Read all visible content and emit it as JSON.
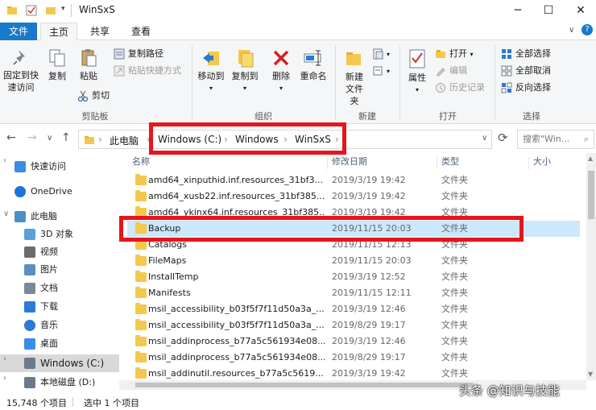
{
  "window": {
    "title": "WinSxS",
    "minimize": "─",
    "maximize": "☐",
    "close": "✕"
  },
  "tabs": {
    "file": "文件",
    "home": "主页",
    "share": "共享",
    "view": "查看"
  },
  "ribbon": {
    "clipboard": {
      "pin": "固定到快速访问",
      "copy": "复制",
      "paste": "粘贴",
      "copy_path": "复制路径",
      "paste_shortcut": "粘贴快捷方式",
      "cut": "剪切",
      "group": "剪贴板"
    },
    "organize": {
      "move_to": "移动到",
      "copy_to": "复制到",
      "delete": "删除",
      "rename": "重命名",
      "group": "组织"
    },
    "new": {
      "new_folder": "新建文件夹",
      "group": "新建"
    },
    "open": {
      "properties": "属性",
      "open": "打开",
      "edit": "编辑",
      "history": "历史记录",
      "group": "打开"
    },
    "select": {
      "select_all": "全部选择",
      "select_none": "全部取消",
      "invert": "反向选择",
      "group": "选择"
    }
  },
  "address": {
    "c1": "此电脑",
    "c2": "Windows (C:)",
    "c3": "Windows",
    "c4": "WinSxS",
    "search_placeholder": "搜索\"Win..."
  },
  "nav": [
    {
      "label": "快速访问",
      "icon": "star-icon",
      "color": "#3a8ee6"
    },
    {
      "label": "OneDrive",
      "icon": "cloud-icon",
      "color": "#1a73d9"
    },
    {
      "label": "此电脑",
      "icon": "computer-icon",
      "color": "#4a90c8"
    },
    {
      "label": "3D 对象",
      "icon": "cube-icon",
      "color": "#5aa0d8"
    },
    {
      "label": "视频",
      "icon": "video-icon",
      "color": "#6c6c6c"
    },
    {
      "label": "图片",
      "icon": "picture-icon",
      "color": "#5a8fbf"
    },
    {
      "label": "文档",
      "icon": "document-icon",
      "color": "#7a8a9a"
    },
    {
      "label": "下载",
      "icon": "download-icon",
      "color": "#2a7ad6"
    },
    {
      "label": "音乐",
      "icon": "music-icon",
      "color": "#2a7ad6"
    },
    {
      "label": "桌面",
      "icon": "desktop-icon",
      "color": "#3a8ee6"
    },
    {
      "label": "Windows (C:)",
      "icon": "drive-icon",
      "color": "#6a7a8a"
    },
    {
      "label": "本地磁盘 (D:)",
      "icon": "drive-icon",
      "color": "#6a7a8a"
    }
  ],
  "columns": {
    "name": "名称",
    "date": "修改日期",
    "type": "类型",
    "size": "大小"
  },
  "files": [
    {
      "name": "amd64_xinputhid.inf.resources_31bf3...",
      "date": "2019/3/19 19:42",
      "type": "文件夹"
    },
    {
      "name": "amd64_xusb22.inf.resources_31bf385...",
      "date": "2019/3/19 19:42",
      "type": "文件夹"
    },
    {
      "name": "amd64_ykinx64.inf.resources_31bf385...",
      "date": "2019/3/19 19:42",
      "type": "文件夹"
    },
    {
      "name": "Backup",
      "date": "2019/11/15 20:03",
      "type": "文件夹"
    },
    {
      "name": "Catalogs",
      "date": "2019/11/15 12:13",
      "type": "文件夹"
    },
    {
      "name": "FileMaps",
      "date": "2019/11/15 20:03",
      "type": "文件夹"
    },
    {
      "name": "InstallTemp",
      "date": "2019/3/19 12:52",
      "type": "文件夹"
    },
    {
      "name": "Manifests",
      "date": "2019/11/15 12:11",
      "type": "文件夹"
    },
    {
      "name": "msil_accessibility_b03f5f7f11d50a3a_...",
      "date": "2019/3/19 12:46",
      "type": "文件夹"
    },
    {
      "name": "msil_accessibility_b03f5f7f11d50a3a_...",
      "date": "2019/8/29 19:17",
      "type": "文件夹"
    },
    {
      "name": "msil_addinprocess_b77a5c561934e08...",
      "date": "2019/3/19 12:46",
      "type": "文件夹"
    },
    {
      "name": "msil_addinprocess_b77a5c561934e08...",
      "date": "2019/8/29 19:17",
      "type": "文件夹"
    },
    {
      "name": "msil_addinutil.resources_b77a5c5619...",
      "date": "2019/3/19 19:42",
      "type": "文件夹"
    }
  ],
  "status": {
    "count": "15,748 个项目",
    "selected": "选中 1 个项目"
  },
  "watermark": "头条 @知识与技能"
}
